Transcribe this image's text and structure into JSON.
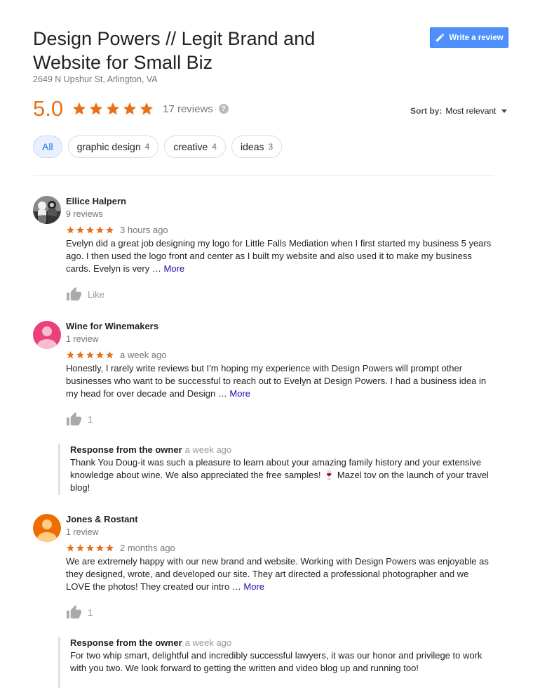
{
  "business": {
    "name": "Design Powers // Legit Brand and Website for Small Biz",
    "address": "2649 N Upshur St, Arlington, VA",
    "rating": "5.0",
    "review_count": "17 reviews",
    "help_glyph": "?"
  },
  "write_review": {
    "label": "Write a review",
    "icon": "pencil-icon"
  },
  "sort": {
    "label": "Sort by:",
    "value": "Most relevant"
  },
  "chips": [
    {
      "label": "All",
      "count": ""
    },
    {
      "label": "graphic design",
      "count": "4"
    },
    {
      "label": "creative",
      "count": "4"
    },
    {
      "label": "ideas",
      "count": "3"
    }
  ],
  "colors": {
    "star": "#e7711b",
    "accent": "#4d90fe",
    "link": "#1a0dab"
  },
  "reviews": [
    {
      "name": "Ellice Halpern",
      "count": "9 reviews",
      "stars": 5,
      "time": "3 hours ago",
      "text": "Evelyn did a great job designing my logo for Little Falls Mediation when I first started my business 5 years ago. I then used the logo front and center as I built my website and also used it to make my business cards. Evelyn is very … ",
      "more": "More",
      "like": "Like"
    },
    {
      "name": "Wine for Winemakers",
      "count": "1 review",
      "stars": 5,
      "time": "a week ago",
      "text": "Honestly, I rarely write reviews but I'm hoping my experience with Design Powers will prompt other businesses who want to be successful to reach out to Evelyn at Design Powers. I had a business idea in my head for over decade and Design … ",
      "more": "More",
      "like": "1",
      "avatar_color": "#ec407a"
    },
    {
      "name": "Jones & Rostant",
      "count": "1 review",
      "stars": 5,
      "time": "2 months ago",
      "text": "We are extremely happy with our new brand and website. Working with Design Powers was enjoyable as they designed, wrote, and developed our site. They art directed a professional photographer and we LOVE the photos! They created our intro … ",
      "more": "More",
      "like": "1",
      "avatar_color": "#ef6c00"
    }
  ],
  "responses": [
    {
      "label": "Response from the owner",
      "time": "a week ago",
      "text": "Thank You Doug-it was such a pleasure to learn about your amazing family history and your extensive knowledge about wine. We also appreciated the free samples! 🍷 Mazel tov on the launch of your travel blog!"
    },
    {
      "label": "Response from the owner",
      "time": "a week ago",
      "text": "For two whip smart, delightful and incredibly successful lawyers, it was our honor and privilege to work with you two. We look forward to getting the written and video blog up and running too!"
    }
  ]
}
